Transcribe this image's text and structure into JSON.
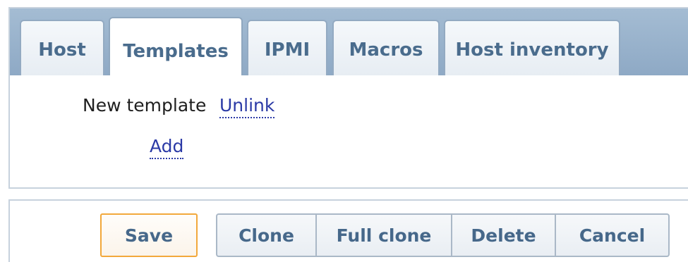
{
  "tabs": [
    {
      "label": "Host",
      "active": false
    },
    {
      "label": "Templates",
      "active": true
    },
    {
      "label": "IPMI",
      "active": false
    },
    {
      "label": "Macros",
      "active": false
    },
    {
      "label": "Host inventory",
      "active": false
    }
  ],
  "templates": {
    "new_template_label": "New template",
    "unlink_label": "Unlink",
    "add_label": "Add"
  },
  "actions": {
    "save_label": "Save",
    "clone_label": "Clone",
    "full_clone_label": "Full clone",
    "delete_label": "Delete",
    "cancel_label": "Cancel"
  },
  "colors": {
    "accent": "#f2a83b",
    "link": "#2b3aa6",
    "tab_text": "#4a6c8d"
  }
}
